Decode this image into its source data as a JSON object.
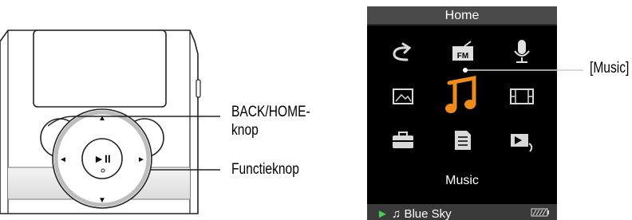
{
  "player_screen": {
    "title": "Home",
    "selected_label": "Music",
    "status_play": "►",
    "status_note": "♫",
    "status_track": "Blue Sky",
    "icons": [
      "shuffle-icon",
      "fm-radio-icon",
      "microphone-icon",
      "photo-icon",
      "music-note-icon",
      "video-icon",
      "settings-icon",
      "playlist-icon",
      "now-playing-icon"
    ],
    "fm_text": "FM",
    "accent_color": "#f08a1a",
    "status_play_color": "#43d34a"
  },
  "callouts": {
    "back_home_line1": "BACK/HOME-",
    "back_home_line2": "knop",
    "function_button": "Functieknop",
    "music": "[Music]"
  },
  "device_buttons": {
    "play_pause": "►II",
    "up": "▲",
    "down": "▼",
    "left": "◄",
    "right": "►"
  }
}
